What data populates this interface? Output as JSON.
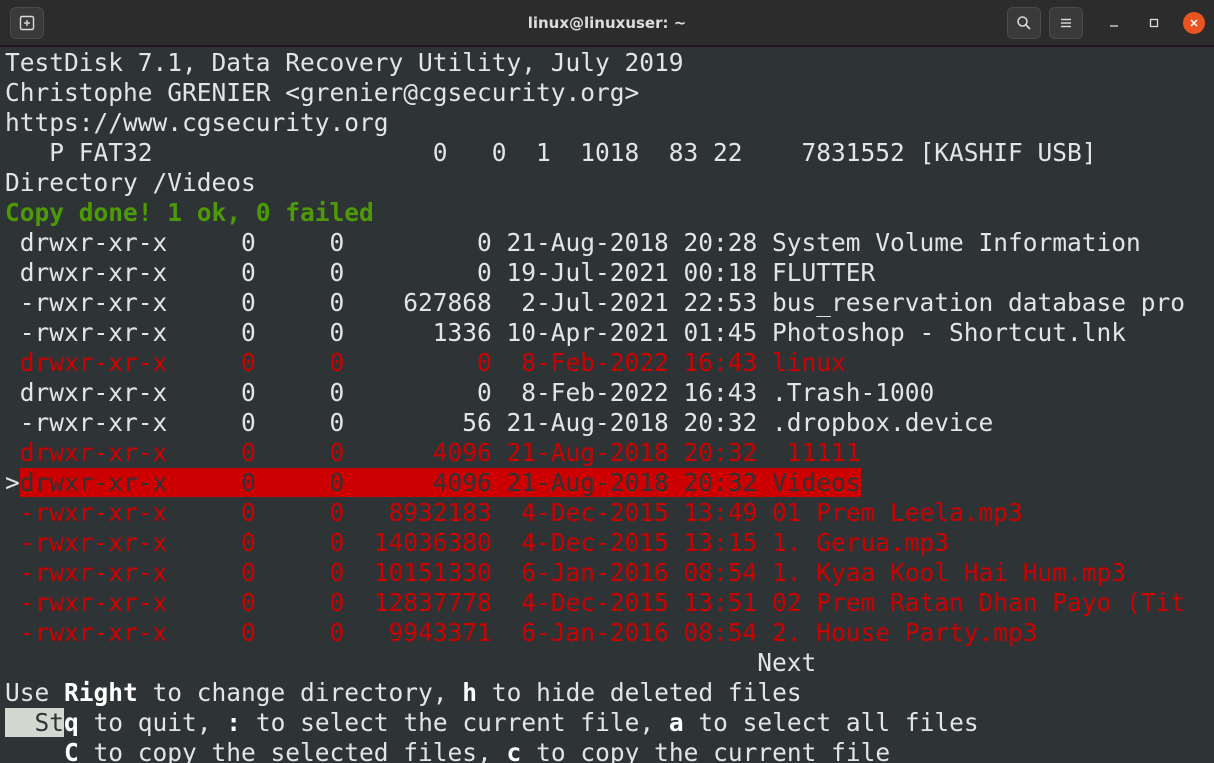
{
  "window": {
    "title": "linux@linuxuser: ~"
  },
  "icons": {
    "new_tab": "new-tab-icon",
    "search": "search-icon",
    "menu": "hamburger-menu-icon",
    "minimize": "minimize-icon",
    "maximize": "maximize-icon",
    "close": "close-icon"
  },
  "colors": {
    "terminal_bg": "#2e3436",
    "deleted": "#cc0000",
    "success": "#4e9a06",
    "close_button": "#e95420"
  },
  "header": {
    "line1": "TestDisk 7.1, Data Recovery Utility, July 2019",
    "line2": "Christophe GRENIER <grenier@cgsecurity.org>",
    "line3": "https://www.cgsecurity.org",
    "partition": "   P FAT32                   0   0  1  1018  83 22    7831552 [KASHIF USB]",
    "directory": "Directory /Videos",
    "status": "Copy done! 1 ok, 0 failed"
  },
  "files": [
    {
      "text": " drwxr-xr-x     0     0         0 21-Aug-2018 20:28 System Volume Information",
      "deleted": false,
      "selected": false
    },
    {
      "text": " drwxr-xr-x     0     0         0 19-Jul-2021 00:18 FLUTTER",
      "deleted": false,
      "selected": false
    },
    {
      "text": " -rwxr-xr-x     0     0    627868  2-Jul-2021 22:53 bus_reservation database pro",
      "deleted": false,
      "selected": false
    },
    {
      "text": " -rwxr-xr-x     0     0      1336 10-Apr-2021 01:45 Photoshop - Shortcut.lnk",
      "deleted": false,
      "selected": false
    },
    {
      "text": " drwxr-xr-x     0     0         0  8-Feb-2022 16:43 linux",
      "deleted": true,
      "selected": false
    },
    {
      "text": " drwxr-xr-x     0     0         0  8-Feb-2022 16:43 .Trash-1000",
      "deleted": false,
      "selected": false
    },
    {
      "text": " -rwxr-xr-x     0     0        56 21-Aug-2018 20:32 .dropbox.device",
      "deleted": false,
      "selected": false
    },
    {
      "text": " drwxr-xr-x     0     0      4096 21-Aug-2018 20:32  11111",
      "deleted": true,
      "selected": false
    },
    {
      "text": "drwxr-xr-x     0     0      4096 21-Aug-2018 20:32 Videos",
      "deleted": true,
      "selected": true,
      "marker": ">"
    },
    {
      "text": " -rwxr-xr-x     0     0   8932183  4-Dec-2015 13:49 01 Prem Leela.mp3",
      "deleted": true,
      "selected": false
    },
    {
      "text": " -rwxr-xr-x     0     0  14036380  4-Dec-2015 13:15 1. Gerua.mp3",
      "deleted": true,
      "selected": false
    },
    {
      "text": " -rwxr-xr-x     0     0  10151330  6-Jan-2016 08:54 1. Kyaa Kool Hai Hum.mp3",
      "deleted": true,
      "selected": false
    },
    {
      "text": " -rwxr-xr-x     0     0  12837778  4-Dec-2015 13:51 02 Prem Ratan Dhan Payo (Tit",
      "deleted": true,
      "selected": false
    },
    {
      "text": " -rwxr-xr-x     0     0   9943371  6-Jan-2016 08:54 2. House Party.mp3",
      "deleted": true,
      "selected": false
    }
  ],
  "footer": {
    "next_indent": "                                                   ",
    "next": "Next",
    "help1": {
      "a": "Use ",
      "b": "Right",
      "c": " to change directory, ",
      "d": "h",
      "e": " to hide deleted files"
    },
    "help2": {
      "cursor": "  St",
      "d": "q",
      "e": " to quit, ",
      "f": ":",
      "g": " to select the current file, ",
      "h": "a",
      "i": " to select all files"
    },
    "help3": {
      "a": "    ",
      "b": "C",
      "c": " to copy the selected files, ",
      "d": "c",
      "e": " to copy the current file"
    }
  }
}
